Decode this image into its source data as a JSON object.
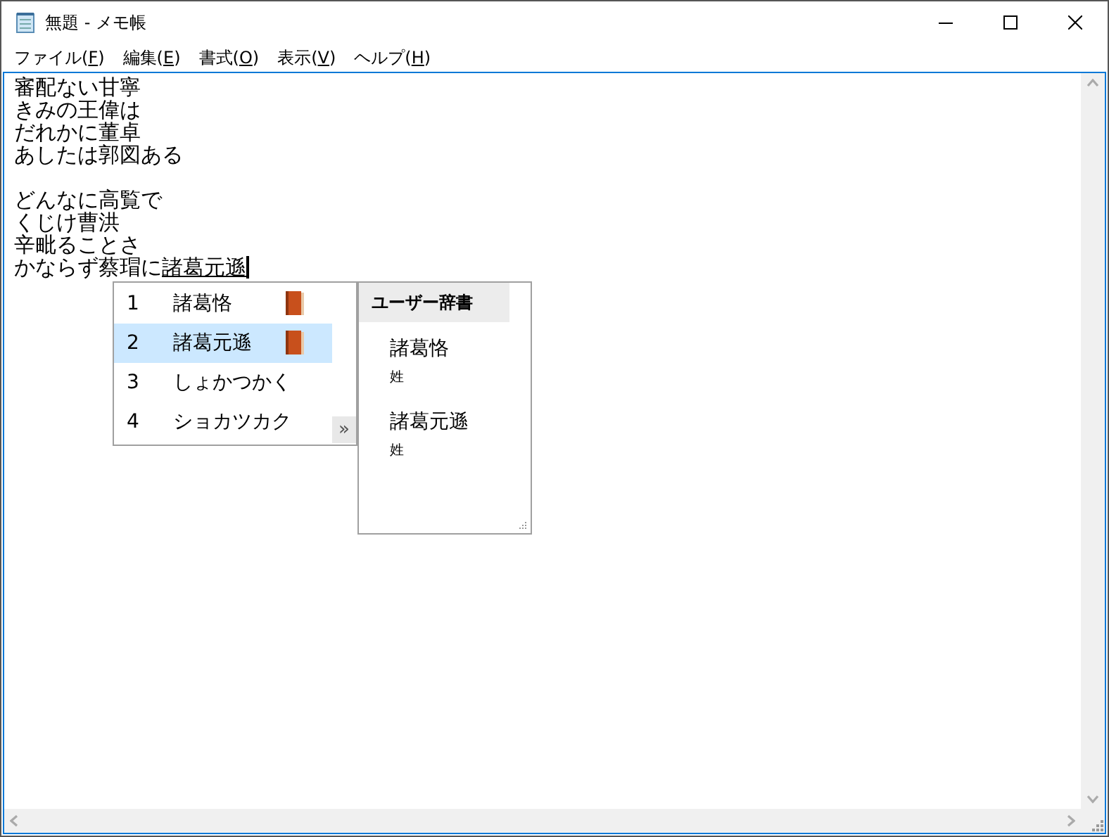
{
  "window": {
    "title": "無題 - メモ帳"
  },
  "menu": [
    {
      "before": "ファイル(",
      "key": "F",
      "after": ")"
    },
    {
      "before": "編集(",
      "key": "E",
      "after": ")"
    },
    {
      "before": "書式(",
      "key": "O",
      "after": ")"
    },
    {
      "before": "表示(",
      "key": "V",
      "after": ")"
    },
    {
      "before": "ヘルプ(",
      "key": "H",
      "after": ")"
    }
  ],
  "editor": {
    "lines": [
      {
        "kind": "text",
        "text": "審配ない甘寧"
      },
      {
        "kind": "text",
        "text": "きみの王偉は"
      },
      {
        "kind": "text",
        "text": "だれかに董卓"
      },
      {
        "kind": "text",
        "text": "あしたは郭図ある"
      },
      {
        "kind": "blank"
      },
      {
        "kind": "text",
        "text": "どんなに高覧で"
      },
      {
        "kind": "text",
        "text": "くじけ曹洪"
      },
      {
        "kind": "text",
        "text": "辛毗ることさ"
      },
      {
        "kind": "composing",
        "text": "かならず蔡瑁に",
        "composition": "諸葛元遜"
      }
    ]
  },
  "candidates": {
    "items": [
      {
        "number": "1",
        "text": "諸葛恪",
        "dictionary": true,
        "selected": false
      },
      {
        "number": "2",
        "text": "諸葛元遜",
        "dictionary": true,
        "selected": true
      },
      {
        "number": "3",
        "text": "しょかつかく",
        "dictionary": false,
        "selected": false
      },
      {
        "number": "4",
        "text": "ショカツカク",
        "dictionary": false,
        "selected": false
      }
    ],
    "expand": "»"
  },
  "detail": {
    "title": "ユーザー辞書",
    "entries": [
      {
        "word": "諸葛恪",
        "note": "姓"
      },
      {
        "word": "諸葛元遜",
        "note": "姓"
      }
    ]
  }
}
